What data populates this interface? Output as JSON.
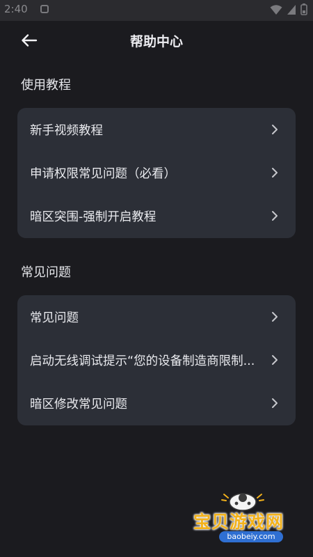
{
  "status_bar": {
    "time": "2:40"
  },
  "header": {
    "title": "帮助中心",
    "back_icon": "arrow-left-icon"
  },
  "sections": [
    {
      "title": "使用教程",
      "items": [
        {
          "label": "新手视频教程"
        },
        {
          "label": "申请权限常见问题（必看）"
        },
        {
          "label": "暗区突围-强制开启教程"
        }
      ]
    },
    {
      "title": "常见问题",
      "items": [
        {
          "label": "常见问题"
        },
        {
          "label": "启动无线调试提示“您的设备制造商限制..."
        },
        {
          "label": "暗区修改常见问题"
        }
      ]
    }
  ],
  "watermark": {
    "text": "宝贝游戏网",
    "url": "baobeiy.com"
  },
  "colors": {
    "background": "#1b1b1f",
    "card": "#2c2f37",
    "text": "#e9eaee",
    "watermark": "#f3b21b"
  }
}
